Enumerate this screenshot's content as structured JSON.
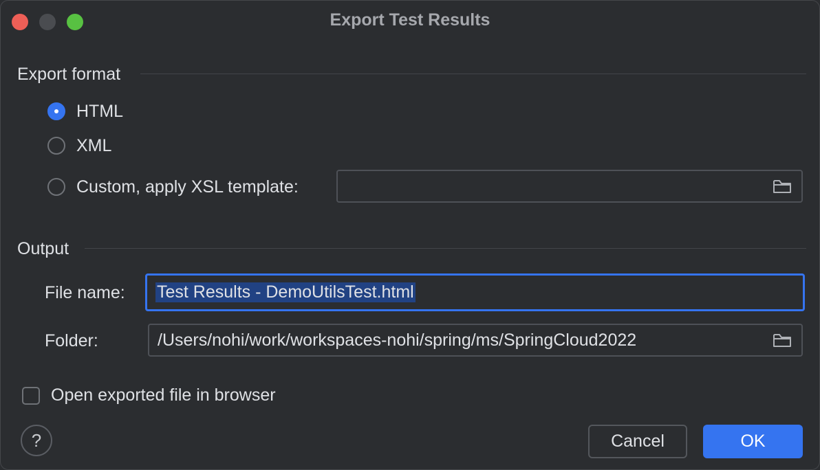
{
  "window": {
    "title": "Export Test Results"
  },
  "export_format": {
    "section_label": "Export format",
    "options": [
      {
        "label": "HTML",
        "checked": true
      },
      {
        "label": "XML",
        "checked": false
      },
      {
        "label": "Custom, apply XSL template:",
        "checked": false
      }
    ],
    "xsl_template_value": ""
  },
  "output": {
    "section_label": "Output",
    "file_name_label": "File name:",
    "file_name_value": "Test Results - DemoUtilsTest.html",
    "folder_label": "Folder:",
    "folder_value": "/Users/nohi/work/workspaces-nohi/spring/ms/SpringCloud2022"
  },
  "open_in_browser": {
    "label": "Open exported file in browser",
    "checked": false
  },
  "help": {
    "glyph": "?"
  },
  "buttons": {
    "cancel_label": "Cancel",
    "ok_label": "OK"
  },
  "colors": {
    "accent": "#3574f0",
    "background": "#2b2d30",
    "close": "#ee5f57",
    "zoom": "#58c142"
  },
  "icons": [
    "folder-icon",
    "help-icon"
  ]
}
